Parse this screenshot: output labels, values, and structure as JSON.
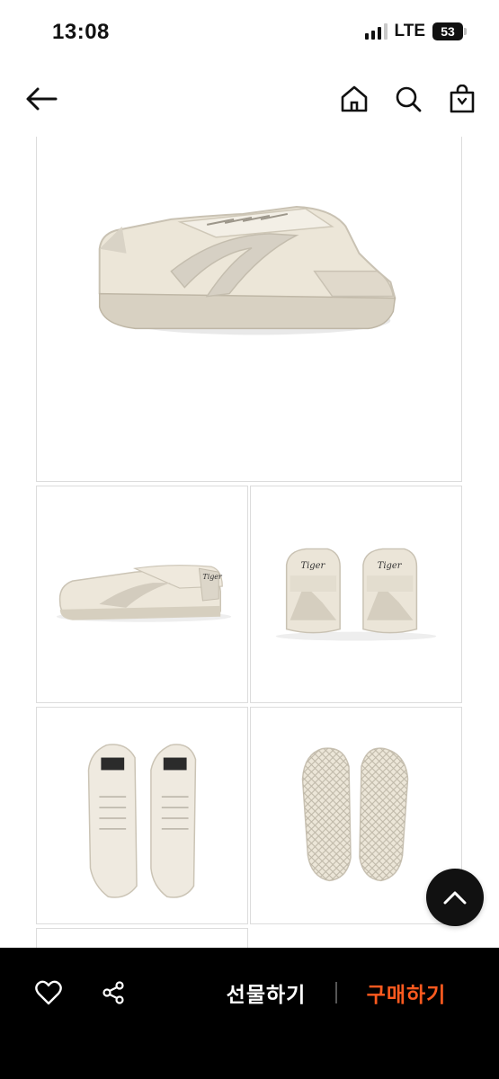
{
  "status_bar": {
    "time": "13:08",
    "network": "LTE",
    "battery": "53",
    "icons": [
      "signal-icon",
      "battery-icon"
    ]
  },
  "header": {
    "icons": [
      "back-arrow-icon",
      "home-icon",
      "search-icon",
      "shopping-bag-icon"
    ]
  },
  "gallery": {
    "images": [
      "sneaker-side-view-icon",
      "sneaker-side-pair-icon",
      "sneaker-heel-pair-icon",
      "sneaker-top-pair-icon",
      "sneaker-sole-pair-icon",
      "sneaker-partial-icon"
    ],
    "heel_logo": "Tiger"
  },
  "actions": {
    "scroll_top_icon": "chevron-up-icon",
    "wishlist_icon": "heart-icon",
    "share_icon": "share-icon",
    "gift_label": "선물하기",
    "buy_label": "구매하기",
    "buy_color": "#ff5a1f"
  }
}
